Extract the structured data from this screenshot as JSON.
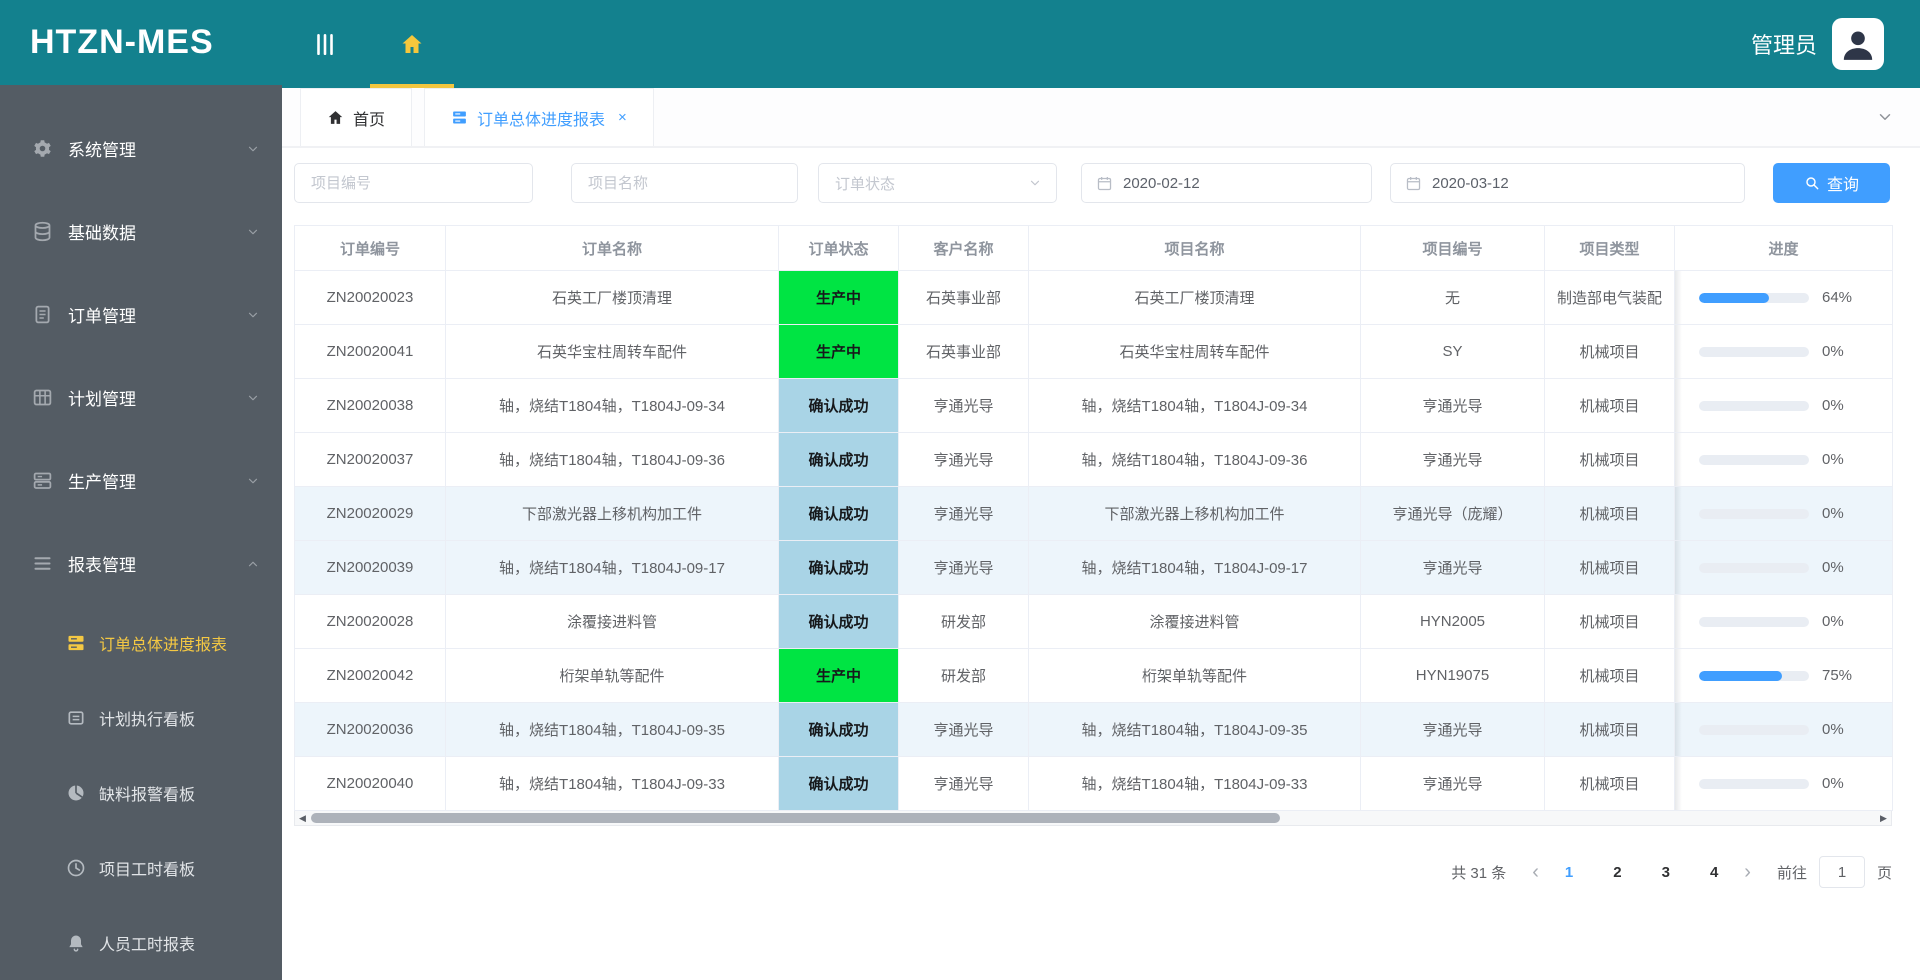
{
  "app": {
    "logo": "HTZN-MES",
    "user_name": "管理员"
  },
  "colors": {
    "brand_teal": "#13818E",
    "sidebar_bg": "#545C64",
    "active_gold": "#F4C843",
    "primary_blue": "#409EFF",
    "status_green": "#00E443",
    "status_light_blue": "#A9D4E6"
  },
  "sidebar": {
    "items": [
      {
        "label": "系统管理",
        "icon": "gear-icon",
        "expanded": false
      },
      {
        "label": "基础数据",
        "icon": "database-icon",
        "expanded": false
      },
      {
        "label": "订单管理",
        "icon": "order-icon",
        "expanded": false
      },
      {
        "label": "计划管理",
        "icon": "plan-icon",
        "expanded": false
      },
      {
        "label": "生产管理",
        "icon": "production-icon",
        "expanded": false
      },
      {
        "label": "报表管理",
        "icon": "report-icon",
        "expanded": true
      }
    ],
    "sub_items": [
      {
        "label": "订单总体进度报表",
        "icon": "progress-report-icon",
        "active": true
      },
      {
        "label": "计划执行看板",
        "icon": "plan-board-icon",
        "active": false
      },
      {
        "label": "缺料报警看板",
        "icon": "shortage-alarm-icon",
        "active": false
      },
      {
        "label": "项目工时看板",
        "icon": "project-hours-icon",
        "active": false
      },
      {
        "label": "人员工时报表",
        "icon": "personnel-hours-icon",
        "active": false
      }
    ]
  },
  "tabs": [
    {
      "label": "首页",
      "icon": "home-icon",
      "closable": false,
      "active": false
    },
    {
      "label": "订单总体进度报表",
      "icon": "report-list-icon",
      "closable": true,
      "active": true
    }
  ],
  "filters": {
    "project_no_placeholder": "项目编号",
    "project_name_placeholder": "项目名称",
    "order_status_placeholder": "订单状态",
    "date_from": "2020-02-12",
    "date_to": "2020-03-12",
    "search_label": "查询"
  },
  "table": {
    "columns": [
      "订单编号",
      "订单名称",
      "订单状态",
      "客户名称",
      "项目名称",
      "项目编号",
      "项目类型",
      "进度"
    ],
    "rows": [
      {
        "order_no": "ZN20020023",
        "order_name": "石英工厂楼顶清理",
        "status": "生产中",
        "status_type": "green",
        "customer": "石英事业部",
        "project_name": "石英工厂楼顶清理",
        "project_no": "无",
        "project_type": "制造部电气装配",
        "progress_pct": 64,
        "progress_label": "64%",
        "striped": false
      },
      {
        "order_no": "ZN20020041",
        "order_name": "石英华宝柱周转车配件",
        "status": "生产中",
        "status_type": "green",
        "customer": "石英事业部",
        "project_name": "石英华宝柱周转车配件",
        "project_no": "SY",
        "project_type": "机械项目",
        "progress_pct": 0,
        "progress_label": "0%",
        "striped": false
      },
      {
        "order_no": "ZN20020038",
        "order_name": "轴，烧结T1804轴，T1804J-09-34",
        "status": "确认成功",
        "status_type": "blue",
        "customer": "亨通光导",
        "project_name": "轴，烧结T1804轴，T1804J-09-34",
        "project_no": "亨通光导",
        "project_type": "机械项目",
        "progress_pct": 0,
        "progress_label": "0%",
        "striped": false
      },
      {
        "order_no": "ZN20020037",
        "order_name": "轴，烧结T1804轴，T1804J-09-36",
        "status": "确认成功",
        "status_type": "blue",
        "customer": "亨通光导",
        "project_name": "轴，烧结T1804轴，T1804J-09-36",
        "project_no": "亨通光导",
        "project_type": "机械项目",
        "progress_pct": 0,
        "progress_label": "0%",
        "striped": false
      },
      {
        "order_no": "ZN20020029",
        "order_name": "下部激光器上移机构加工件",
        "status": "确认成功",
        "status_type": "blue",
        "customer": "亨通光导",
        "project_name": "下部激光器上移机构加工件",
        "project_no": "亨通光导（庞耀）",
        "project_type": "机械项目",
        "progress_pct": 0,
        "progress_label": "0%",
        "striped": true
      },
      {
        "order_no": "ZN20020039",
        "order_name": "轴，烧结T1804轴，T1804J-09-17",
        "status": "确认成功",
        "status_type": "blue",
        "customer": "亨通光导",
        "project_name": "轴，烧结T1804轴，T1804J-09-17",
        "project_no": "亨通光导",
        "project_type": "机械项目",
        "progress_pct": 0,
        "progress_label": "0%",
        "striped": true
      },
      {
        "order_no": "ZN20020028",
        "order_name": "涂覆接进料管",
        "status": "确认成功",
        "status_type": "blue",
        "customer": "研发部",
        "project_name": "涂覆接进料管",
        "project_no": "HYN2005",
        "project_type": "机械项目",
        "progress_pct": 0,
        "progress_label": "0%",
        "striped": false
      },
      {
        "order_no": "ZN20020042",
        "order_name": "桁架单轨等配件",
        "status": "生产中",
        "status_type": "green",
        "customer": "研发部",
        "project_name": "桁架单轨等配件",
        "project_no": "HYN19075",
        "project_type": "机械项目",
        "progress_pct": 75,
        "progress_label": "75%",
        "striped": false
      },
      {
        "order_no": "ZN20020036",
        "order_name": "轴，烧结T1804轴，T1804J-09-35",
        "status": "确认成功",
        "status_type": "blue",
        "customer": "亨通光导",
        "project_name": "轴，烧结T1804轴，T1804J-09-35",
        "project_no": "亨通光导",
        "project_type": "机械项目",
        "progress_pct": 0,
        "progress_label": "0%",
        "striped": true
      },
      {
        "order_no": "ZN20020040",
        "order_name": "轴，烧结T1804轴，T1804J-09-33",
        "status": "确认成功",
        "status_type": "blue",
        "customer": "亨通光导",
        "project_name": "轴，烧结T1804轴，T1804J-09-33",
        "project_no": "亨通光导",
        "project_type": "机械项目",
        "progress_pct": 0,
        "progress_label": "0%",
        "striped": false
      }
    ]
  },
  "pagination": {
    "total_label": "共 31 条",
    "prev_label": "‹",
    "next_label": "›",
    "pages": [
      {
        "label": "1",
        "active": true
      },
      {
        "label": "2",
        "active": false
      },
      {
        "label": "3",
        "active": false
      },
      {
        "label": "4",
        "active": false
      }
    ],
    "goto_label": "前往",
    "goto_value": "1",
    "page_unit": "页"
  }
}
